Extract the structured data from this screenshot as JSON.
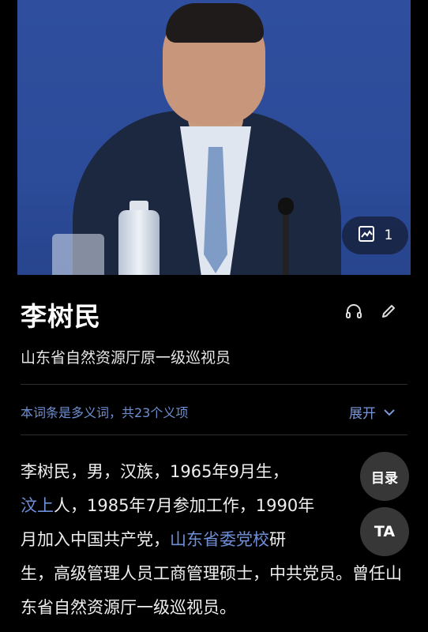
{
  "photo": {
    "gallery_count": "1"
  },
  "entry": {
    "name": "李树民",
    "subtitle": "山东省自然资源厅原一级巡视员",
    "polysemy_note": "本词条是多义词，共23个义项",
    "expand_label": "展开"
  },
  "body": {
    "seg1": "李树民，男，汉族，1965年9月生，",
    "link1": "汶上",
    "seg2": "人，1985年7月参加工作，1990年",
    "seg3": "月加入中国共产党，",
    "link2": "山东省委党校",
    "seg4": "研",
    "seg5": "生，高级管理人员工商管理硕士，中共党员。曾任山东省自然资源厅一级巡视员。"
  },
  "floating": {
    "toc_label": "目录",
    "font_label": "TA"
  },
  "colors": {
    "link": "#6f8fd8",
    "background": "#000000"
  },
  "icons": [
    "gallery-icon",
    "headphones-icon",
    "edit-pencil-icon",
    "chevron-down-icon"
  ]
}
